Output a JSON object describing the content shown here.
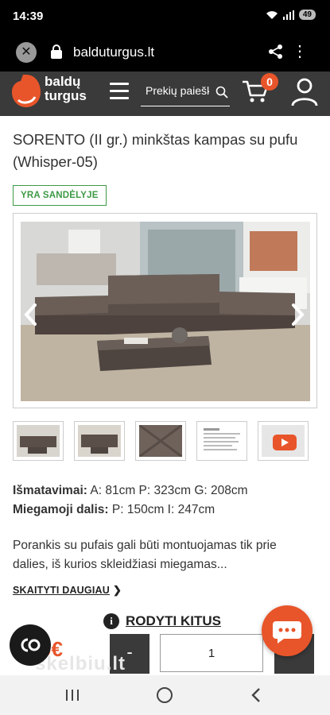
{
  "status_bar": {
    "time": "14:39",
    "battery": "49"
  },
  "browser": {
    "url": "balduturgus.lt"
  },
  "header": {
    "logo_line1": "baldų",
    "logo_line2": "turgus",
    "search_placeholder": "Prekių paieška",
    "cart_count": "0"
  },
  "product": {
    "title": "SORENTO (II gr.) minkštas kampas su pufu (Whisper-05)",
    "stock_label": "YRA SANDĖLYJE",
    "dimensions_label": "Išmatavimai:",
    "dimensions_value": "A: 81cm P: 323cm G: 208cm",
    "sleeping_label": "Miegamoji dalis:",
    "sleeping_value": "P: 150cm I: 247cm",
    "description": "Porankis su pufais gali būti montuojamas tik prie dalies, iš kurios skleidžiasi miegamas...",
    "read_more": "SKAITYTI DAUGIAU",
    "show_others": "RODYTI KITUS"
  },
  "purchase": {
    "price": "9€",
    "minus": "-",
    "quantity": "1"
  },
  "watermark": "skelbiu.lt",
  "colors": {
    "accent": "#e8552a",
    "header_bg": "#3a3a3a",
    "stock_green": "#3d9a45"
  }
}
